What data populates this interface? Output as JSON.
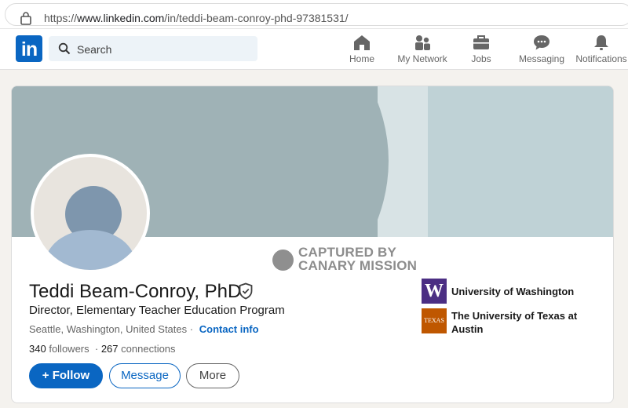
{
  "browser": {
    "url_prefix": "https://",
    "url_domain": "www.linkedin.com",
    "url_path": "/in/teddi-beam-conroy-phd-97381531/"
  },
  "nav": {
    "logo": "in",
    "search_placeholder": "Search",
    "items": [
      {
        "label": "Home",
        "icon": "home-icon"
      },
      {
        "label": "My Network",
        "icon": "network-icon"
      },
      {
        "label": "Jobs",
        "icon": "briefcase-icon"
      },
      {
        "label": "Messaging",
        "icon": "chat-icon"
      },
      {
        "label": "Notifications",
        "icon": "bell-icon"
      }
    ]
  },
  "watermark": {
    "line1": "CAPTURED BY",
    "line2": "CANARY MISSION"
  },
  "profile": {
    "name": "Teddi Beam-Conroy, PhD",
    "headline": "Director, Elementary Teacher Education Program",
    "location": "Seattle, Washington, United States",
    "separator": "·",
    "contact_info": "Contact info",
    "followers_count": "340",
    "followers_label": "followers",
    "connections_count": "267",
    "connections_label": "connections",
    "dot": "·"
  },
  "actions": {
    "follow": "+ Follow",
    "message": "Message",
    "more": "More"
  },
  "education": [
    {
      "name": "University of Washington",
      "logo_text": "W"
    },
    {
      "name": "The University of Texas at Austin",
      "logo_text": "TEXAS"
    }
  ],
  "colors": {
    "brand": "#0a66c2",
    "uw_purple": "#4b2e83",
    "ut_orange": "#bf5700"
  }
}
